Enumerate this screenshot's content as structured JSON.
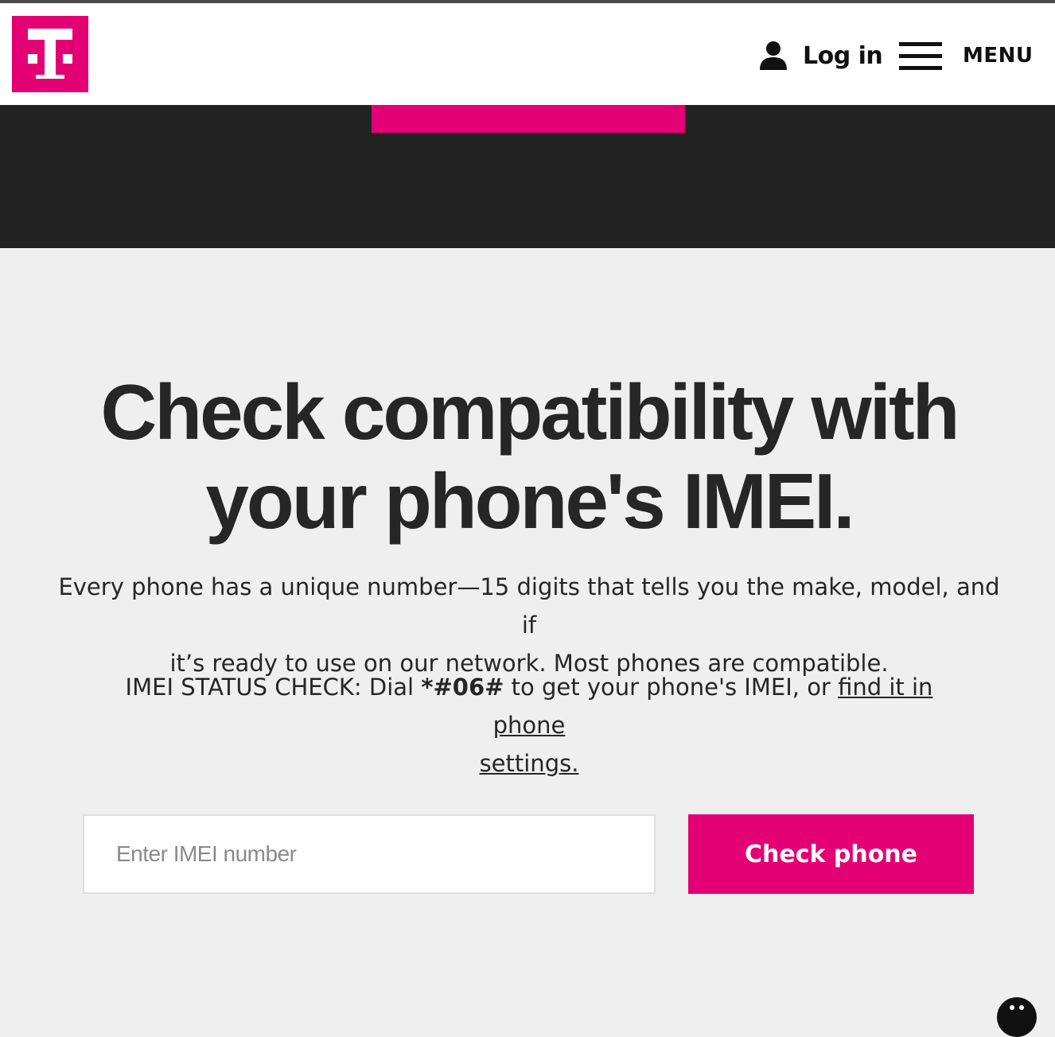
{
  "header": {
    "logo_letter": "T",
    "login_label": "Log in",
    "menu_label": "MENU"
  },
  "main": {
    "headline_line1": "Check compatibility with",
    "headline_line2": "your phone's IMEI.",
    "intro_line1": "Every phone has a unique number—15 digits that tells you the make, model, and if",
    "intro_line2": "it’s ready to use on our network. Most phones are compatible.",
    "status_prefix": "IMEI STATUS CHECK: Dial ",
    "status_code": "*#06#",
    "status_middle": " to get your phone's IMEI, or ",
    "status_link_line1": "find it in phone",
    "status_link_line2": "settings."
  },
  "form": {
    "imei_value": "",
    "imei_placeholder": "Enter IMEI number",
    "check_button_label": "Check phone"
  },
  "icons": {
    "logo": "t-mobile-logo-icon",
    "login": "person-icon",
    "menu": "hamburger-icon",
    "chat": "chat-icon"
  },
  "colors": {
    "brand": "#e20074",
    "dark_band": "#222222",
    "page_background": "#efefef",
    "text": "#262626"
  }
}
